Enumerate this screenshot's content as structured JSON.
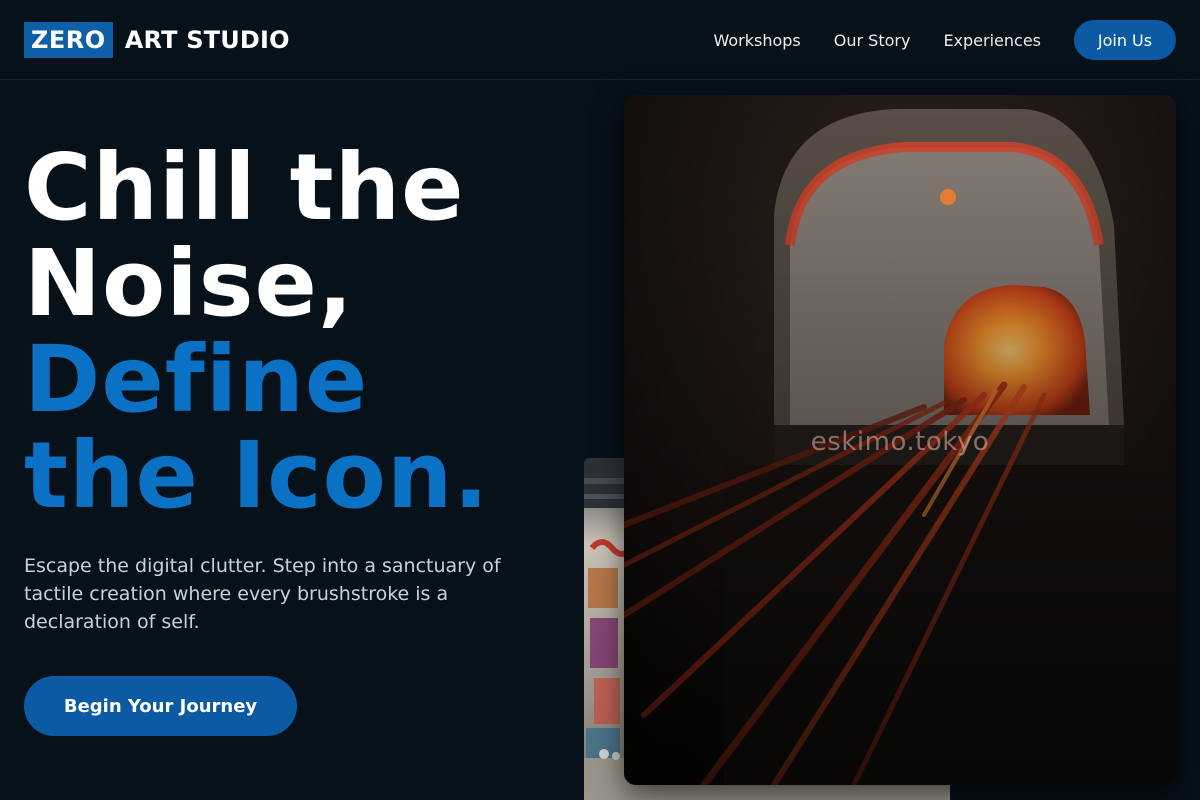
{
  "brand": {
    "badge": "ZERO",
    "name": "ART STUDIO"
  },
  "nav": {
    "items": [
      "Workshops",
      "Our Story",
      "Experiences"
    ],
    "join_label": "Join Us"
  },
  "hero": {
    "title_lines": [
      "Chill the",
      "Noise,",
      "Define",
      "the Icon."
    ],
    "subtitle": "Escape the digital clutter. Step into a sanctuary of tactile creation where every brushstroke is a declaration of self.",
    "cta_label": "Begin Your Journey"
  },
  "images": {
    "front_watermark": "eskimo.tokyo"
  },
  "colors": {
    "background": "#06111a",
    "accent": "#0b5aa3",
    "title_blue": "#0b71c4"
  }
}
